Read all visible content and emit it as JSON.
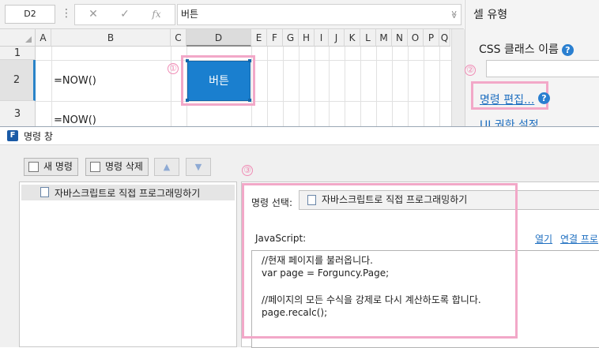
{
  "formula_bar": {
    "name_box": "D2",
    "separator": "⋮",
    "cancel_icon": "✕",
    "confirm_icon": "✓",
    "fx_icon": "fx",
    "value": "버튼",
    "dropdown_icon": "≫"
  },
  "sheet": {
    "columns": [
      "A",
      "B",
      "C",
      "D",
      "E",
      "F",
      "G",
      "H",
      "I",
      "J",
      "K",
      "L",
      "M",
      "N",
      "O",
      "P",
      "Q"
    ],
    "selected_column": "D",
    "rows": [
      "1",
      "2",
      "3"
    ],
    "selected_row": "2",
    "cells": {
      "b2": "=NOW()",
      "b3": "=NOW()",
      "d2_button": "버튼"
    }
  },
  "right_panel": {
    "title": "셀 유형",
    "css_class_label": "CSS 클래스 이름",
    "help_icon": "?",
    "edit_command_link": "명령 편집...",
    "ui_link": "UI 권한 설정"
  },
  "dialog": {
    "title": "명령 창",
    "app_icon": "F",
    "toolbar": {
      "new_command": "새 명령",
      "delete_command": "명령 삭제",
      "move_up": "▲",
      "move_down": "▼"
    },
    "command_list": [
      "자바스크립트로 직접 프로그래밍하기"
    ],
    "detail": {
      "select_label": "명령 선택:",
      "selected_command": "자바스크립트로 직접 프로그래밍하기",
      "js_label": "JavaScript:",
      "open_link": "열기",
      "connect_link": "연결 프로",
      "code_lines": [
        "//현재 페이지를 불러옵니다.",
        "var page = Forguncy.Page;",
        "",
        "//페이지의 모든 수식을 강제로 다시 계산하도록 합니다.",
        "page.recalc();"
      ]
    }
  },
  "annotations": {
    "one": "①",
    "two": "②",
    "three": "③"
  },
  "colors": {
    "accent": "#1a7fcf",
    "highlight": "#f2a8c8",
    "link": "#1f6fc0"
  }
}
